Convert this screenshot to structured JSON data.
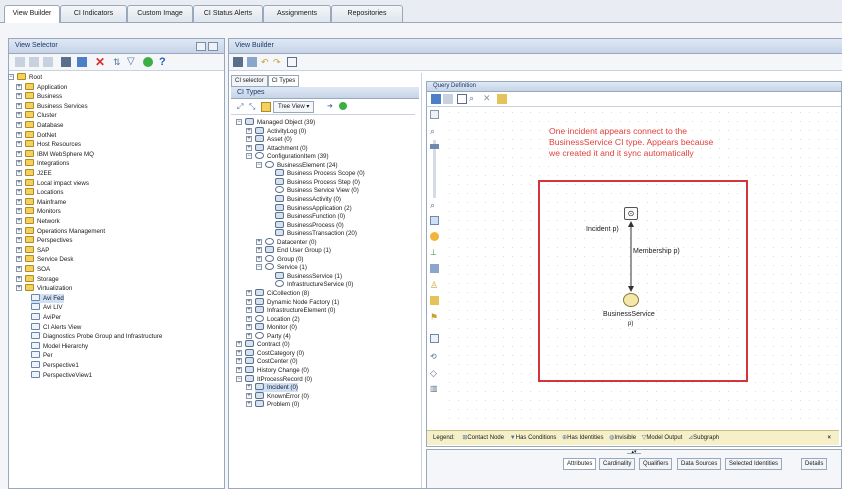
{
  "tabs": [
    "View Builder",
    "CI Indicators",
    "Custom Image",
    "CI Status Alerts",
    "Assignments",
    "Repositories"
  ],
  "view_selector": {
    "title": "View Selector",
    "tree": [
      "Root",
      "Application",
      "Business",
      "Business Services",
      "Cluster",
      "Database",
      "DotNet",
      "Host Resources",
      "IBM WebSphere MQ",
      "Integrations",
      "J2EE",
      "Local impact views",
      "Locations",
      "Mainframe",
      "Monitors",
      "Network",
      "Operations Management",
      "Perspectives",
      "SAP",
      "Service Desk",
      "SOA",
      "Storage",
      "Virtualization",
      "Avi Fed",
      "Avi LIV",
      "AviPer",
      "CI Alerts View",
      "Diagnostics Probe Group and Infrastructure",
      "Model Hierarchy",
      "Per",
      "Perspective1",
      "PerspectiveView1"
    ]
  },
  "view_builder": {
    "title": "View Builder",
    "subtabs": [
      "CI selector",
      "CI Types"
    ],
    "ci_types_title": "CI Types",
    "tree_view_label": "Tree View",
    "ci_tree": [
      "Managed Object (39)",
      "ActivityLog (0)",
      "Asset (0)",
      "Attachment (0)",
      "ConfigurationItem (39)",
      "BusinessElement (24)",
      "Business Process Scope (0)",
      "Business Process Step (0)",
      "Business Service View (0)",
      "BusinessActivity (0)",
      "BusinessApplication (2)",
      "BusinessFunction (0)",
      "BusinessProcess (0)",
      "BusinessTransaction (20)",
      "Datacenter (0)",
      "End User Group (1)",
      "Group (0)",
      "Service (1)",
      "BusinessService (1)",
      "InfrastructureService (0)",
      "CiCollection (8)",
      "Dynamic Node Factory (1)",
      "InfrastructureElement (0)",
      "Location (2)",
      "Monitor (0)",
      "Party (4)",
      "Contract (0)",
      "CostCategory (0)",
      "CostCenter (0)",
      "History Change (0)",
      "ItProcessRecord (0)",
      "Incident (0)",
      "KnownError (0)",
      "Problem (0)"
    ]
  },
  "query": {
    "title": "Query Definition",
    "annotation": [
      "One incident appears connect to the",
      "BusinessService CI type. Appears because",
      "we created it and it sync automatically"
    ],
    "nodes": {
      "incident": "Incident p)",
      "membership": "Membership p)",
      "business_service": "BusinessService",
      "bs_sub": "p)"
    },
    "legend": {
      "label": "Legend:",
      "items": [
        "Contact Node",
        "Has Conditions",
        "Has Identities",
        "Invisible",
        "Model Output",
        "Subgraph"
      ],
      "close": "×"
    },
    "bottom_tabs": [
      "Attributes",
      "Cardinality",
      "Qualifiers",
      "Data Sources",
      "Selected Identities",
      "Details"
    ]
  },
  "colors": {
    "accent": "#1b3a66",
    "note": "#e0403a",
    "box": "#d2353a",
    "panel_head": "#c6d4e8"
  }
}
